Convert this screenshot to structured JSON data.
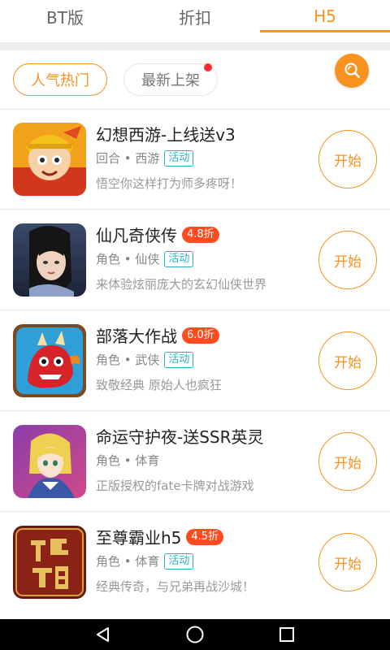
{
  "tabs": [
    {
      "label": "BT版",
      "active": false
    },
    {
      "label": "折扣",
      "active": false
    },
    {
      "label": "H5",
      "active": true
    }
  ],
  "filters": {
    "hot": "人气热门",
    "newest": "最新上架"
  },
  "colors": {
    "accent": "#f7931e",
    "discount": "#ff4b1f",
    "activity": "#27b4c8"
  },
  "games": [
    {
      "title": "幻想西游-上线送v3",
      "discount": "",
      "category": "回合 • 西游",
      "tag": "活动",
      "desc": "悟空你这样打为师多疼呀！",
      "button": "开始"
    },
    {
      "title": "仙凡奇侠传",
      "discount": "4.8折",
      "category": "角色 • 仙侠",
      "tag": "活动",
      "desc": "来体验炫丽庞大的玄幻仙侠世界",
      "button": "开始"
    },
    {
      "title": "部落大作战",
      "discount": "6.0折",
      "category": "角色 • 武侠",
      "tag": "活动",
      "desc": "致敬经典 原始人也疯狂",
      "button": "开始"
    },
    {
      "title": "命运守护夜-送SSR英灵",
      "discount": "",
      "category": "角色 • 体育",
      "tag": "",
      "desc": "正版授权的fate卡牌对战游戏",
      "button": "开始"
    },
    {
      "title": "至尊霸业h5",
      "discount": "4.5折",
      "category": "角色 • 体育",
      "tag": "活动",
      "desc": "经典传奇，与兄弟再战沙城！",
      "button": "开始"
    }
  ],
  "icons": {
    "search": "search-icon",
    "back": "back-triangle-icon",
    "home": "home-circle-icon",
    "recents": "recents-square-icon"
  }
}
